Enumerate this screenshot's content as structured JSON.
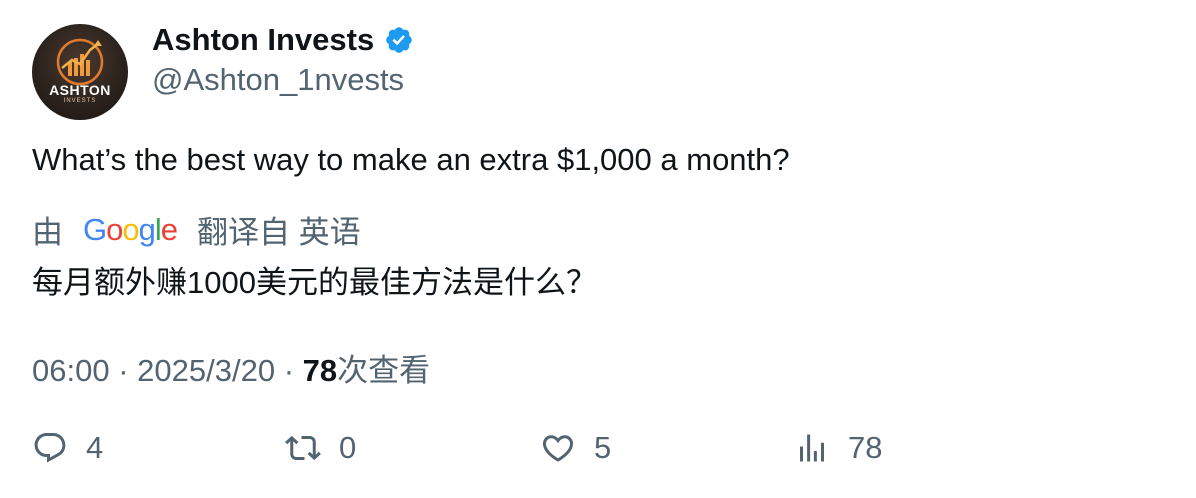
{
  "author": {
    "display_name": "Ashton Invests",
    "handle": "@Ashton_1nvests",
    "avatar_text": "ASHTON",
    "avatar_subtext": "INVESTS",
    "verified_icon": "verified-badge-icon"
  },
  "tweet": {
    "text": "What’s the best way to make an extra $1,000 a month?",
    "translation_prefix": "由",
    "translation_provider": "Google",
    "translation_suffix": "翻译自 英语",
    "translated_text": "每月额外赚1000美元的最佳方法是什么？"
  },
  "meta": {
    "time": "06:00",
    "separator": "·",
    "date": "2025/3/20",
    "views_count": "78",
    "views_label": "次查看"
  },
  "actions": {
    "replies": "4",
    "retweets": "0",
    "likes": "5",
    "views": "78"
  },
  "colors": {
    "text_primary": "#0f1419",
    "text_secondary": "#536471",
    "verified_blue": "#1d9bf0"
  }
}
